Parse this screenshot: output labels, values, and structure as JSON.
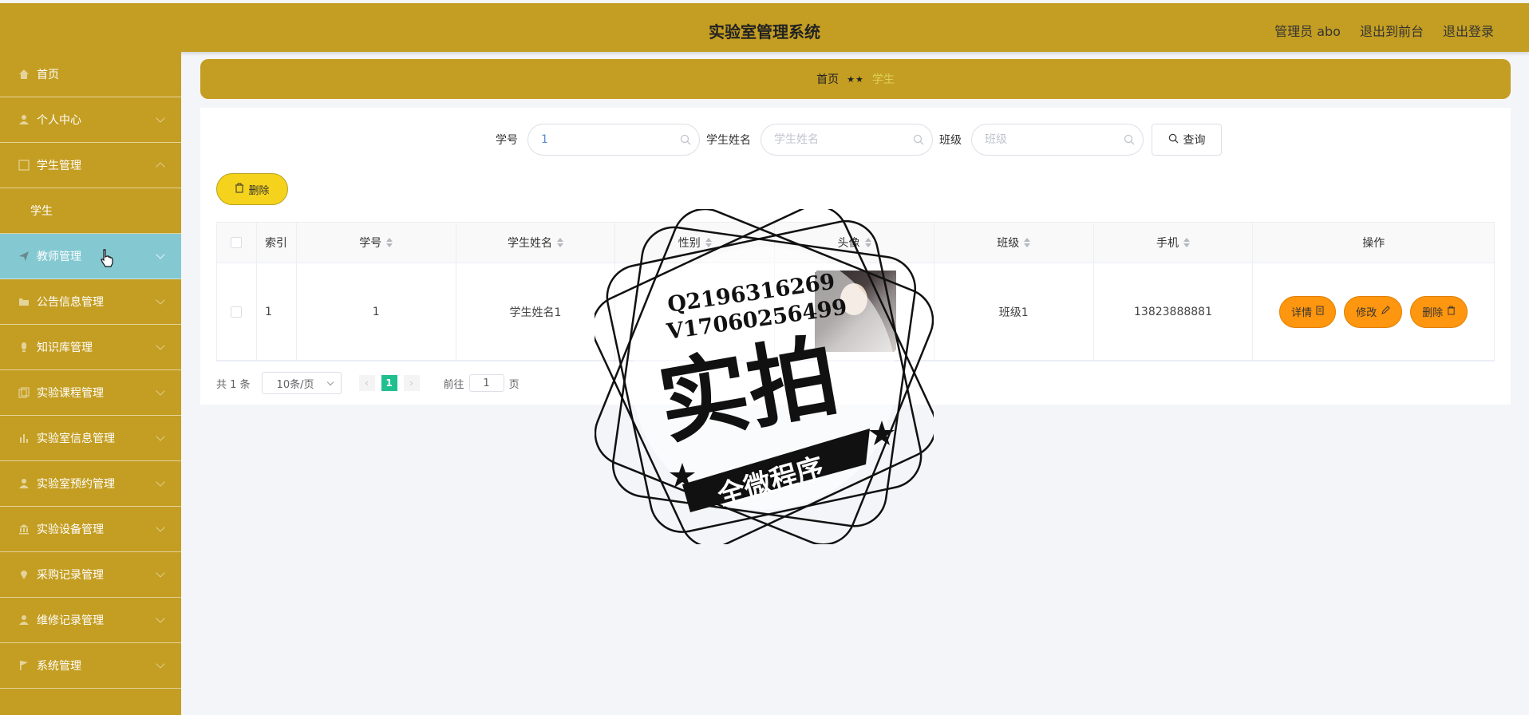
{
  "header": {
    "title": "实验室管理系统",
    "admin": "管理员 abo",
    "exit_front": "退出到前台",
    "logout": "退出登录"
  },
  "sidebar": {
    "items": [
      {
        "label": "首页",
        "icon": "home-icon"
      },
      {
        "label": "个人中心",
        "icon": "user-icon"
      },
      {
        "label": "学生管理",
        "icon": "grid-icon"
      },
      {
        "label": "学生",
        "sub": true
      },
      {
        "label": "教师管理",
        "icon": "send-icon",
        "active": true
      },
      {
        "label": "公告信息管理",
        "icon": "folder-icon"
      },
      {
        "label": "知识库管理",
        "icon": "bulb-icon"
      },
      {
        "label": "实验课程管理",
        "icon": "copy-icon"
      },
      {
        "label": "实验室信息管理",
        "icon": "chart-icon"
      },
      {
        "label": "实验室预约管理",
        "icon": "user-icon"
      },
      {
        "label": "实验设备管理",
        "icon": "bank-icon"
      },
      {
        "label": "采购记录管理",
        "icon": "location-icon"
      },
      {
        "label": "维修记录管理",
        "icon": "user-icon"
      },
      {
        "label": "系统管理",
        "icon": "flag-icon"
      }
    ]
  },
  "breadcrumb": {
    "home": "首页",
    "separator": "★★",
    "current": "学生"
  },
  "search": {
    "student_no_label": "学号",
    "student_no_value": "1",
    "student_name_label": "学生姓名",
    "student_name_placeholder": "学生姓名",
    "class_label": "班级",
    "class_placeholder": "班级",
    "query_label": "查询"
  },
  "toolbar": {
    "delete_label": "删除"
  },
  "table": {
    "columns": [
      "索引",
      "学号",
      "学生姓名",
      "性别",
      "头像",
      "班级",
      "手机",
      "操作"
    ],
    "rows": [
      {
        "index": "1",
        "student_no": "1",
        "name": "学生姓名1",
        "gender": "",
        "class": "班级1",
        "phone": "13823888881"
      }
    ],
    "ops": {
      "detail": "详情",
      "edit": "修改",
      "delete": "删除"
    }
  },
  "pager": {
    "total": "共 1 条",
    "page_size": "10条/页",
    "current_page": "1",
    "goto_label": "前往",
    "goto_value": "1",
    "page_suffix": "页"
  },
  "watermark": {
    "line1": "Q2196316269",
    "line2": "V17060256499",
    "main": "实拍",
    "ribbon": "全微程序"
  },
  "colors": {
    "brand": "#c49e22",
    "active_menu": "#84c9d2",
    "op_button": "#ff960f",
    "delete_button": "#f5d21c",
    "pager_active": "#1fbf8f"
  }
}
